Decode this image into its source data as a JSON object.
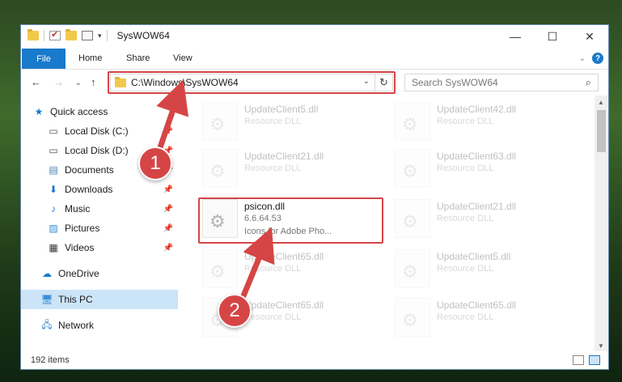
{
  "window": {
    "title": "SysWOW64"
  },
  "ribbon": {
    "file": "File",
    "tabs": [
      "Home",
      "Share",
      "View"
    ]
  },
  "nav": {
    "address": "C:\\Windows\\SysWOW64",
    "search_placeholder": "Search SysWOW64"
  },
  "sidebar": {
    "items": [
      {
        "label": "Quick access",
        "icon": "star-icon"
      },
      {
        "label": "Local Disk (C:)",
        "icon": "drive-icon",
        "pinned": true
      },
      {
        "label": "Local Disk (D:)",
        "icon": "drive-icon",
        "pinned": true
      },
      {
        "label": "Documents",
        "icon": "documents-icon",
        "pinned": true
      },
      {
        "label": "Downloads",
        "icon": "download-icon",
        "pinned": true
      },
      {
        "label": "Music",
        "icon": "music-icon",
        "pinned": true
      },
      {
        "label": "Pictures",
        "icon": "pictures-icon",
        "pinned": true
      },
      {
        "label": "Videos",
        "icon": "videos-icon",
        "pinned": true
      },
      {
        "label": "OneDrive",
        "icon": "cloud-icon"
      },
      {
        "label": "This PC",
        "icon": "computer-icon",
        "selected": true
      },
      {
        "label": "Network",
        "icon": "network-icon"
      }
    ]
  },
  "files": {
    "col1": [
      {
        "name": "UpdateClient5.dll",
        "type": "Resource DLL"
      },
      {
        "name": "UpdateClient21.dll",
        "type": "Resource DLL"
      },
      {
        "name": "psicon.dll",
        "version": "6.6.64.53",
        "desc": "Icons for Adobe Pho..."
      },
      {
        "name": "UpdateClient65.dll",
        "type": "Resource DLL"
      },
      {
        "name": "UpdateClient65.dll",
        "type": "Resource DLL"
      }
    ],
    "col2": [
      {
        "name": "UpdateClient42.dll",
        "type": "Resource DLL"
      },
      {
        "name": "UpdateClient63.dll",
        "type": "Resource DLL"
      },
      {
        "name": "UpdateClient21.dll",
        "type": "Resource DLL"
      },
      {
        "name": "UpdateClient5.dll",
        "type": "Resource DLL"
      },
      {
        "name": "UpdateClient65.dll",
        "type": "Resource DLL"
      }
    ]
  },
  "status": {
    "count": "192 items"
  },
  "annotations": {
    "step1": "1",
    "step2": "2",
    "color": "#d64545"
  }
}
